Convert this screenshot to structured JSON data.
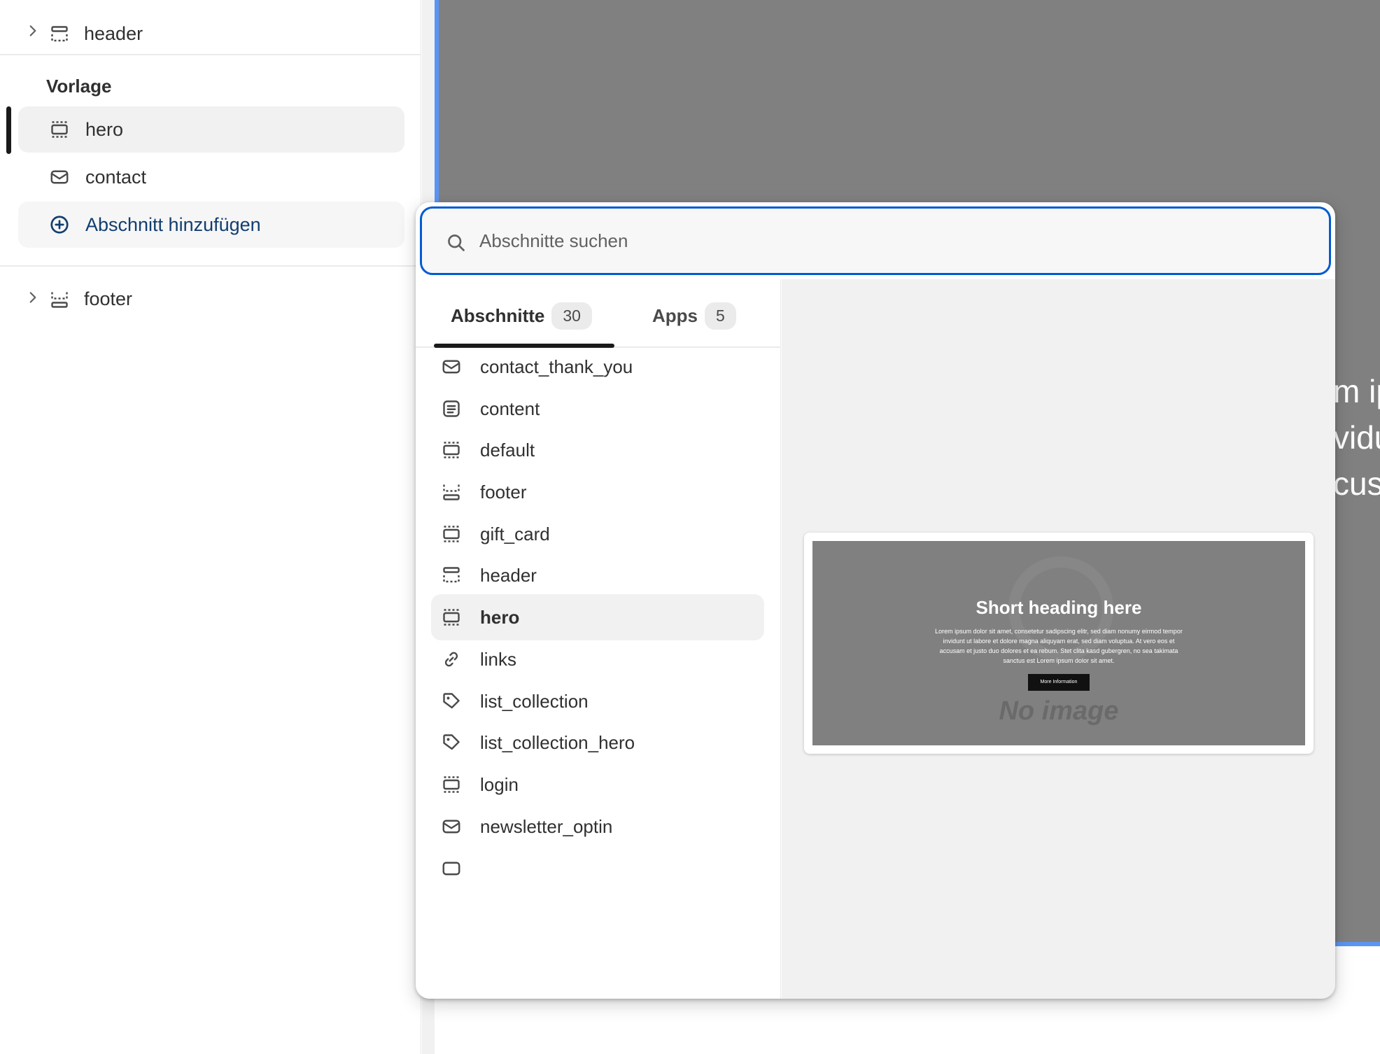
{
  "sidebar": {
    "header_group": {
      "label": "header"
    },
    "template_title": "Vorlage",
    "template_items": [
      {
        "label": "hero",
        "icon": "section-icon",
        "active": true
      },
      {
        "label": "contact",
        "icon": "mail-icon",
        "active": false
      }
    ],
    "add_section_label": "Abschnitt hinzufügen",
    "footer_group": {
      "label": "footer"
    }
  },
  "canvas": {
    "background_text_lines": [
      "m ip",
      "vidu",
      "cusa"
    ]
  },
  "popover": {
    "search": {
      "placeholder": "Abschnitte suchen",
      "value": ""
    },
    "tabs": [
      {
        "label": "Abschnitte",
        "count": "30",
        "active": true
      },
      {
        "label": "Apps",
        "count": "5",
        "active": false
      }
    ],
    "sections": [
      {
        "label": "contact_thank_you",
        "icon": "mail-icon"
      },
      {
        "label": "content",
        "icon": "text-block-icon"
      },
      {
        "label": "default",
        "icon": "section-icon"
      },
      {
        "label": "footer",
        "icon": "footer-icon"
      },
      {
        "label": "gift_card",
        "icon": "section-icon"
      },
      {
        "label": "header",
        "icon": "header-icon"
      },
      {
        "label": "hero",
        "icon": "section-icon",
        "selected": true
      },
      {
        "label": "links",
        "icon": "link-icon"
      },
      {
        "label": "list_collection",
        "icon": "tag-icon"
      },
      {
        "label": "list_collection_hero",
        "icon": "tag-icon"
      },
      {
        "label": "login",
        "icon": "section-icon"
      },
      {
        "label": "newsletter_optin",
        "icon": "mail-icon"
      }
    ],
    "preview": {
      "heading": "Short heading here",
      "body": "Lorem ipsum dolor sit amet, consetetur sadipscing elitr, sed diam nonumy eirmod tempor invidunt ut labore et dolore magna aliquyam erat, sed diam voluptua. At vero eos et accusam et justo duo dolores et ea rebum. Stet clita kasd gubergren, no sea takimata sanctus est Lorem ipsum dolor sit amet.",
      "button_label": "More Information",
      "placeholder_text": "No image"
    }
  },
  "colors": {
    "accent_blue": "#005bd3",
    "link_blue": "#123e6f",
    "canvas_gray": "#808080",
    "selection_blue": "#5a95f5"
  }
}
